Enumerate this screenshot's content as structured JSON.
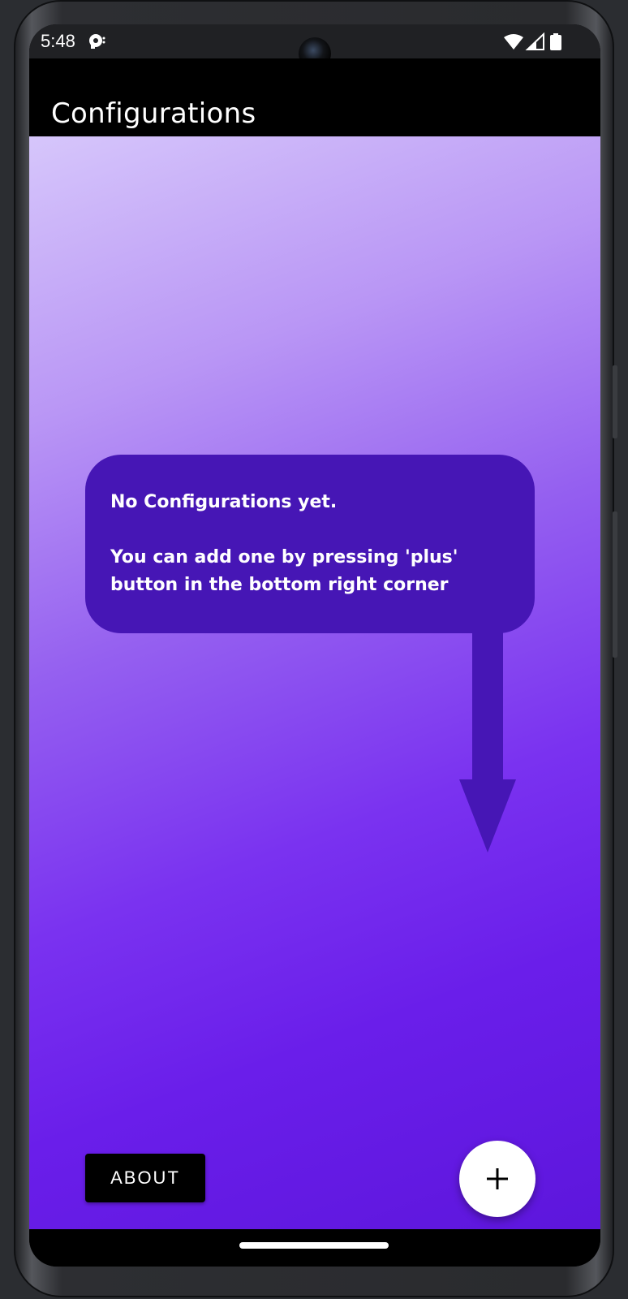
{
  "status_bar": {
    "time": "5:48",
    "notification_icon": "notification-app-icon",
    "icons": [
      "wifi-icon",
      "cell-signal-icon",
      "battery-icon"
    ]
  },
  "app_bar": {
    "title": "Configurations"
  },
  "empty_state": {
    "line1": "No Configurations yet.",
    "line2": "You can add one by pressing 'plus' button in the bottom right corner",
    "pointer_icon": "arrow-down-icon"
  },
  "actions": {
    "about_label": "ABOUT",
    "add_icon": "plus-icon"
  },
  "colors": {
    "bubble": "#4616b5",
    "app_bar": "#000000",
    "gradient_top": "#d6c6fb",
    "gradient_bottom": "#5d16dc",
    "fab": "#ffffff"
  }
}
